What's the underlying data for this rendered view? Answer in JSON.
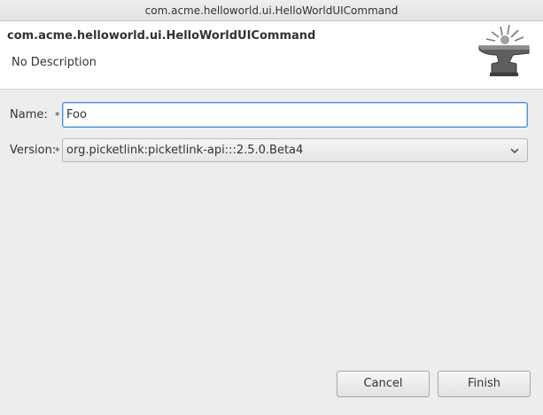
{
  "window": {
    "title": "com.acme.helloworld.ui.HelloWorldUICommand"
  },
  "header": {
    "title": "com.acme.helloworld.ui.HelloWorldUICommand",
    "description": "No Description",
    "icon": "anvil-icon"
  },
  "form": {
    "name_label": "Name:",
    "name_required": "*",
    "name_value": "Foo",
    "version_label": "Version:",
    "version_required": "*",
    "version_value": "org.picketlink:picketlink-api:::2.5.0.Beta4"
  },
  "buttons": {
    "cancel": "Cancel",
    "finish": "Finish"
  },
  "colors": {
    "background": "#ededed",
    "header_background": "#ffffff",
    "focus_border": "#4a90d9"
  }
}
